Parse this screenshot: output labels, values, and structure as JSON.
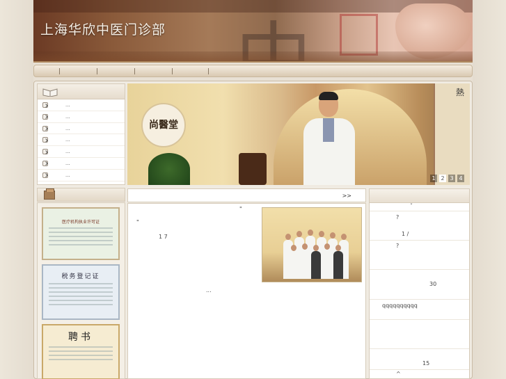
{
  "header": {
    "site_title": "上海华欣中医门诊部",
    "calligraphy": "中"
  },
  "navbar": {
    "items": [
      "",
      "",
      "",
      "",
      ""
    ]
  },
  "sidebar": {
    "items": [
      {
        "label": "..."
      },
      {
        "label": "..."
      },
      {
        "label": "..."
      },
      {
        "label": "..."
      },
      {
        "label": "..."
      },
      {
        "label": "..."
      },
      {
        "label": "..."
      }
    ]
  },
  "certificates": [
    {
      "title": "医疗机构执业许可证"
    },
    {
      "title": "税务登记证"
    },
    {
      "title": "聘书"
    }
  ],
  "slideshow": {
    "plaque_text": "尚醫堂",
    "poster_text": "熱",
    "pages": [
      "1",
      "2",
      "3",
      "4"
    ],
    "active_page": "2"
  },
  "intro": {
    "more_label": ">>",
    "text_a": "\"",
    "text_b": "\"",
    "number_line": "1 7",
    "ellipsis": "..."
  },
  "faq": {
    "lines": [
      {
        "text": "ˇ"
      },
      {
        "text": "?"
      },
      {
        "text": "1 /"
      },
      {
        "text": "?"
      },
      {
        "text": "30"
      },
      {
        "text": "qqqqqqqqqq"
      },
      {
        "text": "15"
      },
      {
        "text": "^"
      }
    ]
  },
  "colors": {
    "background": "#e8e0d4",
    "banner_brown": "#8a5a3a",
    "panel_border": "#d6cbb9"
  }
}
